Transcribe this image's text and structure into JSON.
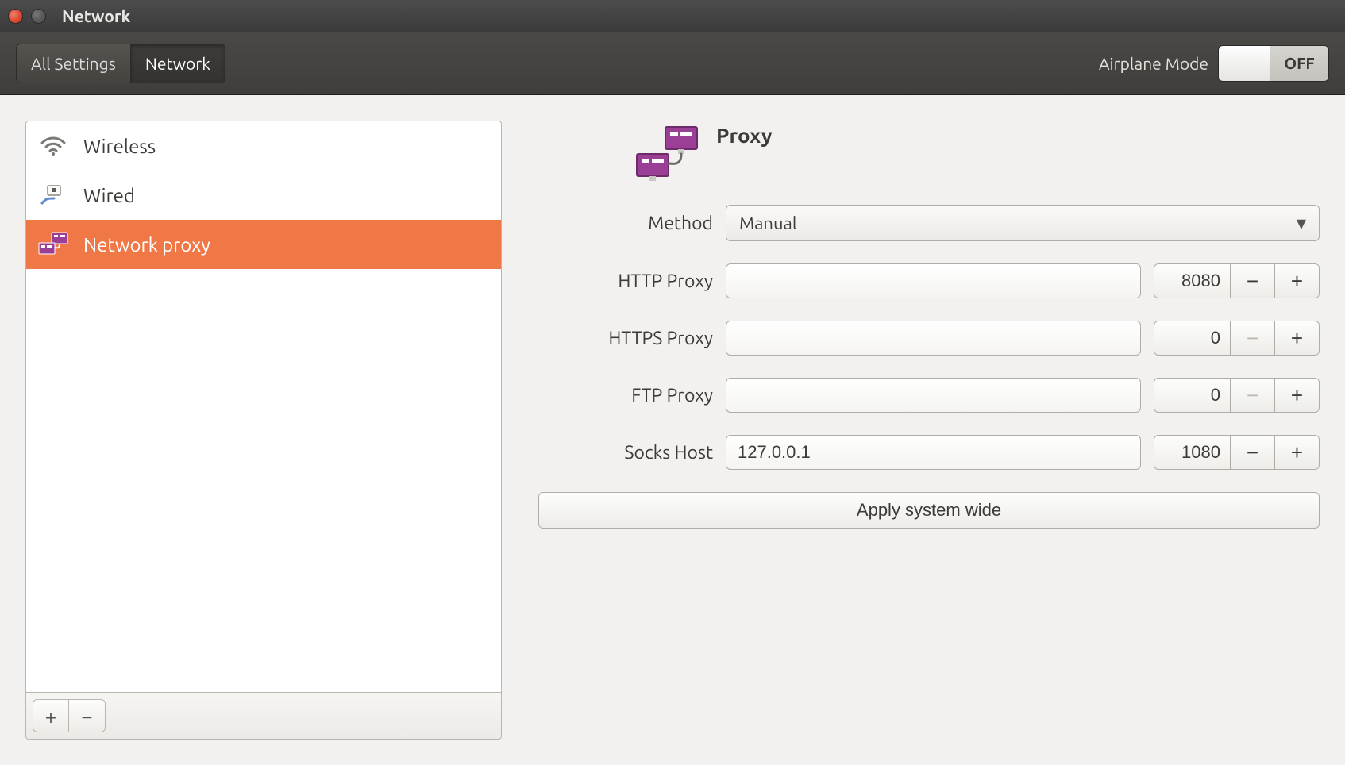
{
  "window": {
    "title": "Network"
  },
  "toolbar": {
    "all_settings": "All Settings",
    "network": "Network",
    "airplane_label": "Airplane Mode",
    "airplane_state": "OFF"
  },
  "sidebar": {
    "items": [
      {
        "label": "Wireless"
      },
      {
        "label": "Wired"
      },
      {
        "label": "Network proxy"
      }
    ],
    "add": "+",
    "remove": "−"
  },
  "panel": {
    "title": "Proxy",
    "method_label": "Method",
    "method_value": "Manual",
    "rows": [
      {
        "label": "HTTP Proxy",
        "host": "",
        "port": "8080"
      },
      {
        "label": "HTTPS Proxy",
        "host": "",
        "port": "0"
      },
      {
        "label": "FTP Proxy",
        "host": "",
        "port": "0"
      },
      {
        "label": "Socks Host",
        "host": "127.0.0.1",
        "port": "1080"
      }
    ],
    "apply": "Apply system wide"
  }
}
